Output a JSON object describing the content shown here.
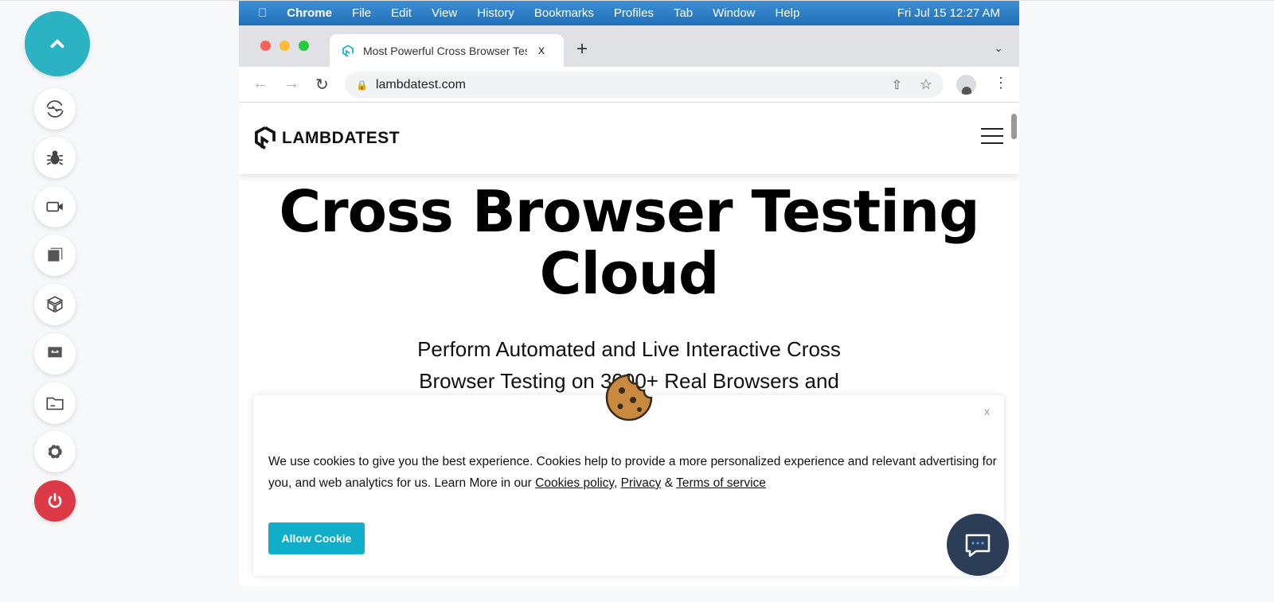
{
  "sidebar": {
    "items": [
      "scroll-up",
      "switch-browser",
      "bug",
      "video",
      "screenshots",
      "3d-box",
      "resolution",
      "file-manager",
      "settings",
      "end-session"
    ],
    "accent": "#2bb3c4",
    "power_color": "#dc3a47"
  },
  "menubar": {
    "app": "Chrome",
    "items": [
      "File",
      "Edit",
      "View",
      "History",
      "Bookmarks",
      "Profiles",
      "Tab",
      "Window",
      "Help"
    ],
    "clock": "Fri Jul 15  12:27 AM"
  },
  "tab": {
    "title": "Most Powerful Cross Browser Testing",
    "close": "x",
    "new": "+"
  },
  "address": {
    "url": "lambdatest.com"
  },
  "site": {
    "logo": "LAMBDATEST",
    "headline1": "Cross Browser Testing",
    "headline2": "Cloud",
    "subtitle": "Perform Automated and Live Interactive Cross Browser Testing on 3000+ Real Browsers and"
  },
  "cookie": {
    "close": "x",
    "text": "We use cookies to give you the best experience. Cookies help to provide a more personalized experience and relevant advertising for you, and web analytics for us. Learn More in our ",
    "link1": "Cookies policy",
    "sep1": ", ",
    "link2": "Privacy",
    "sep2": " & ",
    "link3": "Terms of service",
    "button": "Allow Cookie",
    "button_color": "#10aec9"
  }
}
